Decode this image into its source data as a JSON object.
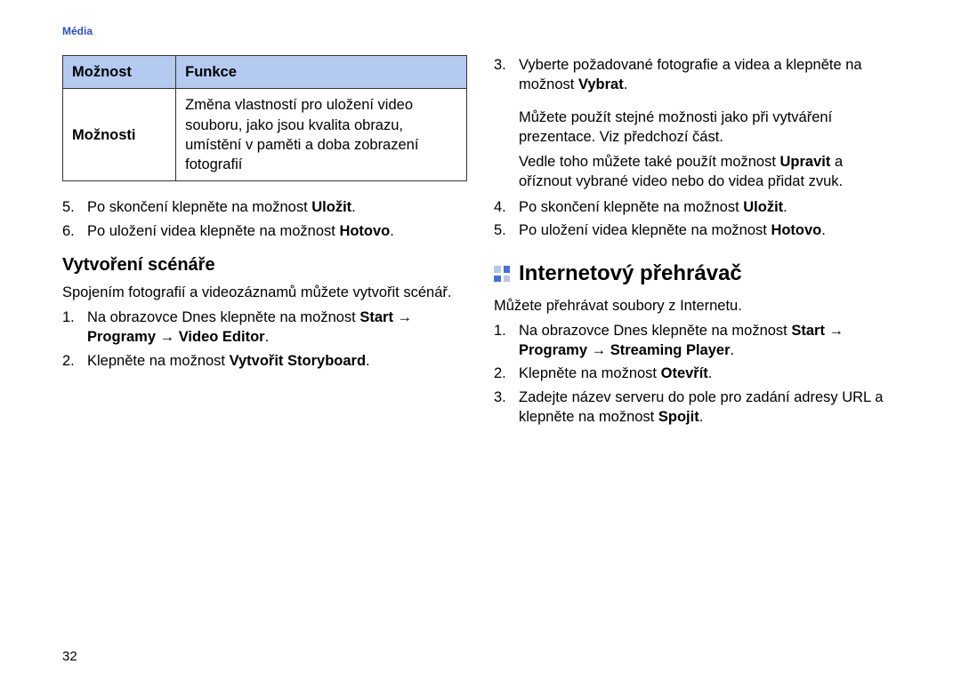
{
  "header_label": "Média",
  "page_number": "32",
  "table": {
    "col1_header": "Možnost",
    "col2_header": "Funkce",
    "row1_col1": "Možnosti",
    "row1_col2": "Změna vlastností pro uložení video souboru, jako jsou kvalita obrazu, umístění v paměti a doba zobrazení fotografií"
  },
  "left_list1": {
    "item5_num": "5.",
    "item5_a": "Po skončení klepněte na možnost ",
    "item5_b": "Uložit",
    "item5_c": ".",
    "item6_num": "6.",
    "item6_a": "Po uložení videa klepněte na možnost ",
    "item6_b": "Hotovo",
    "item6_c": "."
  },
  "subheading1": "Vytvoření scénáře",
  "para1": "Spojením fotografií a videozáznamů můžete vytvořit scénář.",
  "left_list2": {
    "item1_num": "1.",
    "item1_a": "Na obrazovce Dnes klepněte na možnost ",
    "item1_b": "Start → Programy → Video Editor",
    "item1_c": ".",
    "item2_num": "2.",
    "item2_a": "Klepněte na možnost ",
    "item2_b": "Vytvořit Storyboard",
    "item2_c": "."
  },
  "right_list1": {
    "item3_num": "3.",
    "item3_a": "Vyberte požadované fotografie a videa a klepněte na možnost ",
    "item3_b": "Vybrat",
    "item3_c": ".",
    "item3_p2": "Můžete použít stejné možnosti jako při vytváření prezentace. Viz předchozí část.",
    "item3_p3a": "Vedle toho můžete také použít možnost ",
    "item3_p3b": "Upravit",
    "item3_p3c": " a oříznout vybrané video nebo do videa přidat zvuk.",
    "item4_num": "4.",
    "item4_a": "Po skončení klepněte na možnost ",
    "item4_b": "Uložit",
    "item4_c": ".",
    "item5_num": "5.",
    "item5_a": "Po uložení videa klepněte na možnost ",
    "item5_b": "Hotovo",
    "item5_c": "."
  },
  "heading2": "Internetový přehrávač",
  "para2": "Můžete přehrávat soubory z Internetu.",
  "right_list2": {
    "item1_num": "1.",
    "item1_a": "Na obrazovce Dnes klepněte na možnost ",
    "item1_b": "Start → Programy → Streaming Player",
    "item1_c": ".",
    "item2_num": "2.",
    "item2_a": "Klepněte na možnost ",
    "item2_b": "Otevřít",
    "item2_c": ".",
    "item3_num": "3.",
    "item3_a": "Zadejte název serveru do pole pro zadání adresy URL a klepněte na možnost ",
    "item3_b": "Spojit",
    "item3_c": "."
  }
}
